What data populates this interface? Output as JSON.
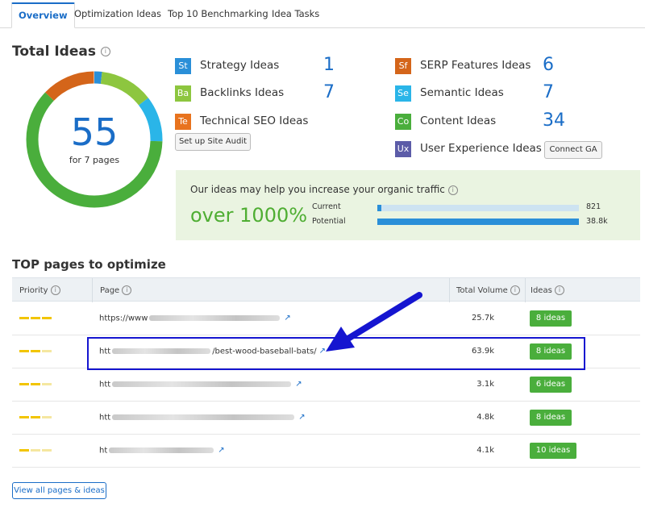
{
  "tabs": [
    {
      "label": "Overview",
      "active": true
    },
    {
      "label": "Optimization Ideas",
      "active": false
    },
    {
      "label": "Top 10 Benchmarking",
      "active": false
    },
    {
      "label": "Idea Tasks",
      "active": false
    }
  ],
  "total_ideas": {
    "title": "Total Ideas",
    "count": "55",
    "subtitle": "for 7 pages"
  },
  "idea_categories": [
    {
      "abbr": "St",
      "label": "Strategy Ideas",
      "count": "1",
      "color": "#2a8fd8"
    },
    {
      "abbr": "Ba",
      "label": "Backlinks Ideas",
      "count": "7",
      "color": "#8dc63f"
    },
    {
      "abbr": "Te",
      "label": "Technical SEO Ideas",
      "count": "",
      "color": "#e8731e"
    },
    {
      "abbr": "Sf",
      "label": "SERP Features Ideas",
      "count": "6",
      "color": "#d4651a"
    },
    {
      "abbr": "Se",
      "label": "Semantic Ideas",
      "count": "7",
      "color": "#2ab5e8"
    },
    {
      "abbr": "Co",
      "label": "Content Ideas",
      "count": "34",
      "color": "#4aae3c"
    },
    {
      "abbr": "Ux",
      "label": "User Experience Ideas",
      "count": "",
      "color": "#5c5ca8"
    }
  ],
  "buttons": {
    "site_audit": "Set up Site Audit",
    "connect_ga": "Connect GA",
    "view_all": "View all pages & ideas"
  },
  "traffic": {
    "title": "Our ideas may help you increase your organic traffic",
    "headline": "over 1000%",
    "current_label": "Current",
    "current_value": "821",
    "current_fraction": 0.02,
    "potential_label": "Potential",
    "potential_value": "38.8k",
    "potential_fraction": 1.0
  },
  "top_pages": {
    "title": "TOP pages to optimize",
    "columns": [
      "Priority",
      "Page",
      "Total Volume",
      "Ideas"
    ],
    "rows": [
      {
        "priority": 3,
        "url_prefix": "https://www",
        "url_suffix": "",
        "volume": "25.7k",
        "ideas": "8 ideas"
      },
      {
        "priority": 3,
        "url_prefix": "htt",
        "url_suffix": "/best-wood-baseball-bats/",
        "volume": "63.9k",
        "ideas": "8 ideas"
      },
      {
        "priority": 3,
        "url_prefix": "htt",
        "url_suffix": "",
        "volume": "3.1k",
        "ideas": "6 ideas"
      },
      {
        "priority": 3,
        "url_prefix": "htt",
        "url_suffix": "",
        "volume": "4.8k",
        "ideas": "8 ideas"
      },
      {
        "priority": 2,
        "url_prefix": "ht",
        "url_suffix": "",
        "volume": "4.1k",
        "ideas": "10 ideas"
      }
    ]
  },
  "colors": {
    "accent": "#1a6dc7",
    "green": "#4aae3c",
    "priority": "#f2c500",
    "annotation": "#1515d0"
  },
  "icons": [
    "info-icon",
    "external-link-icon",
    "annotation-arrow"
  ]
}
